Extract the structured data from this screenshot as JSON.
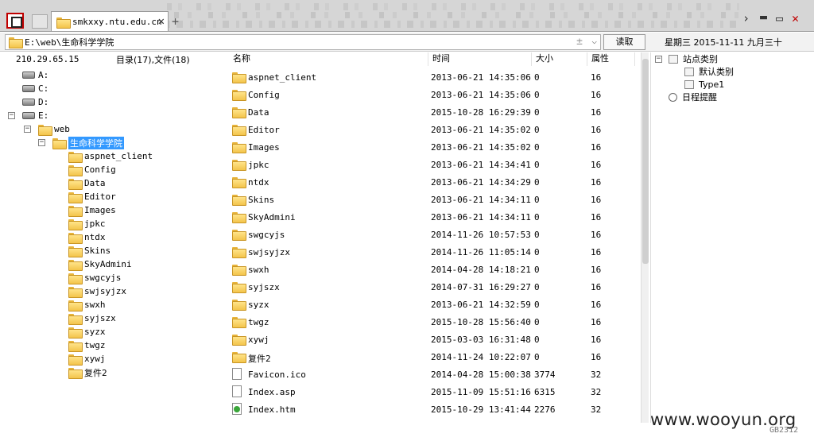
{
  "tab": {
    "title": "smkxxy.ntu.edu.cn"
  },
  "address": {
    "path": "E:\\web\\生命科学学院",
    "read_button": "读取"
  },
  "date_label": "星期三 2015-11-11 九月三十",
  "left_panel": {
    "ip": "210.29.65.15",
    "counts": "目录(17),文件(18)",
    "drives": [
      "A:",
      "C:",
      "D:",
      "E:"
    ],
    "web": "web",
    "selected": "生命科学学院",
    "folders": [
      "aspnet_client",
      "Config",
      "Data",
      "Editor",
      "Images",
      "jpkc",
      "ntdx",
      "Skins",
      "SkyAdmini",
      "swgcyjs",
      "swjsyjzx",
      "swxh",
      "syjszx",
      "syzx",
      "twgz",
      "xywj",
      "复件2"
    ]
  },
  "list": {
    "headers": {
      "name": "名称",
      "time": "时间",
      "size": "大小",
      "attr": "属性"
    },
    "rows": [
      {
        "type": "folder",
        "name": "aspnet_client",
        "time": "2013-06-21 14:35:06",
        "size": "0",
        "attr": "16"
      },
      {
        "type": "folder",
        "name": "Config",
        "time": "2013-06-21 14:35:06",
        "size": "0",
        "attr": "16"
      },
      {
        "type": "folder",
        "name": "Data",
        "time": "2015-10-28 16:29:39",
        "size": "0",
        "attr": "16"
      },
      {
        "type": "folder",
        "name": "Editor",
        "time": "2013-06-21 14:35:02",
        "size": "0",
        "attr": "16"
      },
      {
        "type": "folder",
        "name": "Images",
        "time": "2013-06-21 14:35:02",
        "size": "0",
        "attr": "16"
      },
      {
        "type": "folder",
        "name": "jpkc",
        "time": "2013-06-21 14:34:41",
        "size": "0",
        "attr": "16"
      },
      {
        "type": "folder",
        "name": "ntdx",
        "time": "2013-06-21 14:34:29",
        "size": "0",
        "attr": "16"
      },
      {
        "type": "folder",
        "name": "Skins",
        "time": "2013-06-21 14:34:11",
        "size": "0",
        "attr": "16"
      },
      {
        "type": "folder",
        "name": "SkyAdmini",
        "time": "2013-06-21 14:34:11",
        "size": "0",
        "attr": "16"
      },
      {
        "type": "folder",
        "name": "swgcyjs",
        "time": "2014-11-26 10:57:53",
        "size": "0",
        "attr": "16"
      },
      {
        "type": "folder",
        "name": "swjsyjzx",
        "time": "2014-11-26 11:05:14",
        "size": "0",
        "attr": "16"
      },
      {
        "type": "folder",
        "name": "swxh",
        "time": "2014-04-28 14:18:21",
        "size": "0",
        "attr": "16"
      },
      {
        "type": "folder",
        "name": "syjszx",
        "time": "2014-07-31 16:29:27",
        "size": "0",
        "attr": "16"
      },
      {
        "type": "folder",
        "name": "syzx",
        "time": "2013-06-21 14:32:59",
        "size": "0",
        "attr": "16"
      },
      {
        "type": "folder",
        "name": "twgz",
        "time": "2015-10-28 15:56:40",
        "size": "0",
        "attr": "16"
      },
      {
        "type": "folder",
        "name": "xywj",
        "time": "2015-03-03 16:31:48",
        "size": "0",
        "attr": "16"
      },
      {
        "type": "folder",
        "name": "复件2",
        "time": "2014-11-24 10:22:07",
        "size": "0",
        "attr": "16"
      },
      {
        "type": "file",
        "name": "Favicon.ico",
        "time": "2014-04-28 15:00:38",
        "size": "3774",
        "attr": "32"
      },
      {
        "type": "file",
        "name": "Index.asp",
        "time": "2015-11-09 15:51:16",
        "size": "6315",
        "attr": "32"
      },
      {
        "type": "file-green",
        "name": "Index.htm",
        "time": "2015-10-29 13:41:44",
        "size": "2276",
        "attr": "32"
      }
    ]
  },
  "right_panel": {
    "site_category": "站点类别",
    "default_category": "默认类别",
    "type1": "Type1",
    "schedule": "日程提醒"
  },
  "watermark": "www.wooyun.org",
  "codepage": "GB2312"
}
